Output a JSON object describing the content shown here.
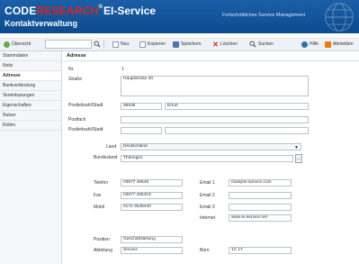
{
  "header": {
    "brand_code": "CODE",
    "brand_research": "RESEARCH",
    "brand_trademark": "®",
    "product": "EI-Service",
    "subtitle": "Kontaktverwaltung",
    "tagline": "Fortschrittliches Service Management"
  },
  "toolbar": {
    "back_label": "Übersicht",
    "search_placeholder": "",
    "new_label": "Neu",
    "copy_label": "Kopieren",
    "save_label": "Speichern",
    "delete_label": "Löschen",
    "find_label": "Suchen",
    "help_label": "Hilfe",
    "logout_label": "Abmelden"
  },
  "sidebar": {
    "items": [
      {
        "label": "Stammdaten"
      },
      {
        "label": "Notiz"
      },
      {
        "label": "Adresse"
      },
      {
        "label": "Bankverbindung"
      },
      {
        "label": "Vereinbarungen"
      },
      {
        "label": "Eigenschaften"
      },
      {
        "label": "Nutzer"
      },
      {
        "label": "Rollen"
      }
    ],
    "active_index": 2
  },
  "address": {
    "section_title": "Adresse",
    "nr_label": "Nr.",
    "nr_value": "1",
    "street_label": "Straße",
    "street_value": "Hauptstraße 20",
    "plzort_label": "Postleitzahl/Stadt",
    "plz_value": "96638",
    "city_value": "Erfurt",
    "postbox_label": "Postfach",
    "postbox_value": "",
    "postbox_plz_label": "Postleitzahl/Stadt",
    "postbox_plz_value": "",
    "postbox_city_value": "",
    "country_label": "Land",
    "country_value": "Deutschland",
    "state_label": "Bundesland",
    "state_value": "Thüringen"
  },
  "contact": {
    "phone_label": "Telefon",
    "phone_value": "03677 46549",
    "fax_label": "Fax",
    "fax_value": "03677 465419",
    "mobile_label": "Mobil",
    "mobile_value": "0172 3039430",
    "email1_label": "Email 1",
    "email1_value": "mail@ei-service.com",
    "email2_label": "Email 2",
    "email2_value": "",
    "email3_label": "Email 3",
    "email3_value": "",
    "web_label": "Internet",
    "web_value": "www.ei-service.net"
  },
  "org": {
    "position_label": "Position",
    "position_value": "Geschäftsleitung",
    "dept_label": "Abteilung",
    "dept_value": "Service",
    "office_label": "Büro",
    "office_value": "1C 17"
  },
  "colors": {
    "header_blue": "#1b5fa8",
    "brand_red": "#d9261c",
    "accent_orange": "#e87a1c"
  }
}
